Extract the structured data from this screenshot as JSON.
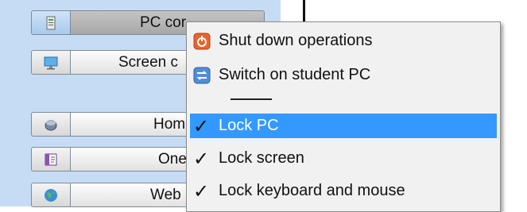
{
  "sidebar": {
    "buttons": [
      {
        "label": "PC cor",
        "icon": "pc-control-icon",
        "active": true
      },
      {
        "label": "Screen c",
        "icon": "monitor-icon",
        "active": false
      },
      {
        "label": "Homew",
        "icon": "homework-icon",
        "active": false
      },
      {
        "label": "OneNo",
        "icon": "onenote-icon",
        "active": false
      },
      {
        "label": "Web bro",
        "icon": "globe-icon",
        "active": false
      }
    ]
  },
  "context_menu": {
    "items": [
      {
        "label": "Shut down operations",
        "icon": "power-icon"
      },
      {
        "label": "Switch on student PC",
        "icon": "switch-icon"
      },
      {
        "label": "Lock PC",
        "icon": "checkmark-icon",
        "checked": true,
        "highlighted": true
      },
      {
        "label": "Lock screen",
        "icon": "checkmark-icon",
        "checked": true
      },
      {
        "label": "Lock keyboard and mouse",
        "icon": "checkmark-icon",
        "checked": true
      }
    ],
    "check_glyph": "✓"
  },
  "colors": {
    "sidebar_bg": "#c6dcf5",
    "highlight": "#3399ff",
    "menu_bg": "#f1f1f1"
  }
}
